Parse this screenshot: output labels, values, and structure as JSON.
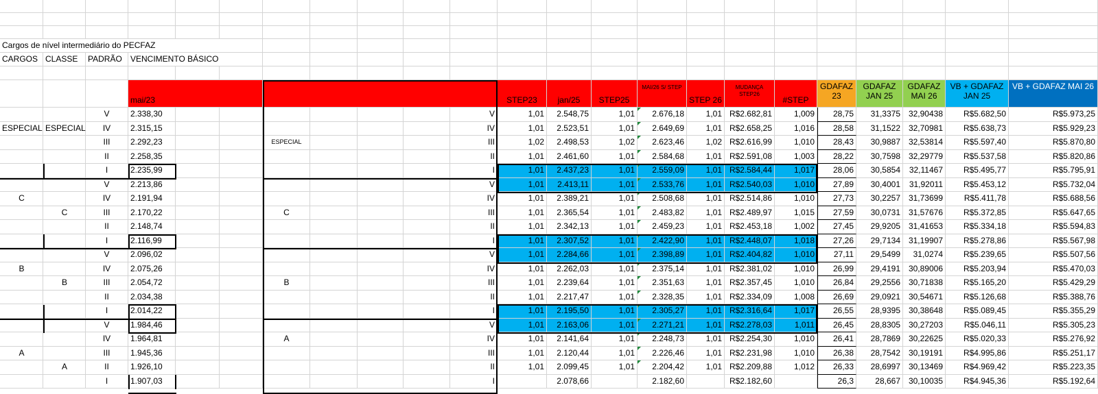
{
  "sheet": {
    "title": "Cargos de nível intermediário do PECFAZ",
    "col_labels": [
      "CARGOS",
      "CLASSE",
      "PADRÃO",
      "VENCIMENTO BÁSICO"
    ],
    "left_header": "mai/23",
    "headers": [
      "STEP23",
      "jan/25",
      "STEP25",
      "MAI/26 S/ STEP",
      "STEP 26",
      "MUDANÇA STEP26",
      "#STEP",
      "GDAFAZ 23",
      "GDAFAZ JAN 25",
      "GDAFAZ MAI 26",
      "VB + GDAFAZ JAN 25",
      "VB + GDAFAZ MAI 26"
    ],
    "group_labels": {
      "cargos": [
        "ESPECIAL",
        "C",
        "B",
        "A"
      ],
      "classe": [
        "ESPECIAL",
        "C",
        "B",
        "A"
      ],
      "middle": [
        "ESPECIAL",
        "C",
        "B",
        "A"
      ]
    },
    "colors": {
      "red": "#ff0000",
      "orange": "#f5a623",
      "green": "#92d050",
      "blue": "#00b0f0",
      "dark_blue": "#0070c0"
    },
    "rows": [
      {
        "p": "V",
        "vb": "2.338,30",
        "s23": "1,01",
        "jan": "2.548,75",
        "s25": "1,01",
        "mai": "2.676,18",
        "s26": "1,01",
        "mud": "R$2.682,81",
        "st": "1,009",
        "g23": "28,75",
        "gj": "31,3375",
        "gm": "32,90438",
        "vj": "R$5.682,50",
        "vm": "R$5.973,25"
      },
      {
        "p": "IV",
        "vb": "2.315,15",
        "s23": "1,01",
        "jan": "2.523,51",
        "s25": "1,01",
        "mai": "2.649,69",
        "s26": "1,01",
        "mud": "R$2.658,25",
        "st": "1,016",
        "g23": "28,58",
        "gj": "31,1522",
        "gm": "32,70981",
        "vj": "R$5.638,73",
        "vm": "R$5.929,23"
      },
      {
        "p": "III",
        "vb": "2.292,23",
        "s23": "1,02",
        "jan": "2.498,53",
        "s25": "1,02",
        "mai": "2.623,46",
        "s26": "1,02",
        "mud": "R$2.616,99",
        "st": "1,010",
        "g23": "28,43",
        "gj": "30,9887",
        "gm": "32,53814",
        "vj": "R$5.597,40",
        "vm": "R$5.870,80"
      },
      {
        "p": "II",
        "vb": "2.258,35",
        "s23": "1,01",
        "jan": "2.461,60",
        "s25": "1,01",
        "mai": "2.584,68",
        "s26": "1,01",
        "mud": "R$2.591,08",
        "st": "1,003",
        "g23": "28,22",
        "gj": "30,7598",
        "gm": "32,29779",
        "vj": "R$5.537,58",
        "vm": "R$5.820,86"
      },
      {
        "p": "I",
        "vb": "2.235,99",
        "s23": "1,01",
        "jan": "2.437,23",
        "s25": "1,01",
        "mai": "2.559,09",
        "s26": "1,01",
        "mud": "R$2.584,44",
        "st": "1,017",
        "g23": "28,06",
        "gj": "30,5854",
        "gm": "32,11467",
        "vj": "R$5.495,77",
        "vm": "R$5.795,91"
      },
      {
        "p": "V",
        "vb": "2.213,86",
        "s23": "1,01",
        "jan": "2.413,11",
        "s25": "1,01",
        "mai": "2.533,76",
        "s26": "1,01",
        "mud": "R$2.540,03",
        "st": "1,010",
        "g23": "27,89",
        "gj": "30,4001",
        "gm": "31,92011",
        "vj": "R$5.453,12",
        "vm": "R$5.732,04"
      },
      {
        "p": "IV",
        "vb": "2.191,94",
        "s23": "1,01",
        "jan": "2.389,21",
        "s25": "1,01",
        "mai": "2.508,68",
        "s26": "1,01",
        "mud": "R$2.514,86",
        "st": "1,010",
        "g23": "27,73",
        "gj": "30,2257",
        "gm": "31,73699",
        "vj": "R$5.411,78",
        "vm": "R$5.688,56"
      },
      {
        "p": "III",
        "vb": "2.170,22",
        "s23": "1,01",
        "jan": "2.365,54",
        "s25": "1,01",
        "mai": "2.483,82",
        "s26": "1,01",
        "mud": "R$2.489,97",
        "st": "1,015",
        "g23": "27,59",
        "gj": "30,0731",
        "gm": "31,57676",
        "vj": "R$5.372,85",
        "vm": "R$5.647,65"
      },
      {
        "p": "II",
        "vb": "2.148,74",
        "s23": "1,01",
        "jan": "2.342,13",
        "s25": "1,01",
        "mai": "2.459,23",
        "s26": "1,01",
        "mud": "R$2.453,18",
        "st": "1,002",
        "g23": "27,45",
        "gj": "29,9205",
        "gm": "31,41653",
        "vj": "R$5.334,18",
        "vm": "R$5.594,83"
      },
      {
        "p": "I",
        "vb": "2.116,99",
        "s23": "1,01",
        "jan": "2.307,52",
        "s25": "1,01",
        "mai": "2.422,90",
        "s26": "1,01",
        "mud": "R$2.448,07",
        "st": "1,018",
        "g23": "27,26",
        "gj": "29,7134",
        "gm": "31,19907",
        "vj": "R$5.278,86",
        "vm": "R$5.567,98"
      },
      {
        "p": "V",
        "vb": "2.096,02",
        "s23": "1,01",
        "jan": "2.284,66",
        "s25": "1,01",
        "mai": "2.398,89",
        "s26": "1,01",
        "mud": "R$2.404,82",
        "st": "1,010",
        "g23": "27,11",
        "gj": "29,5499",
        "gm": "31,0274",
        "vj": "R$5.239,65",
        "vm": "R$5.507,56"
      },
      {
        "p": "IV",
        "vb": "2.075,26",
        "s23": "1,01",
        "jan": "2.262,03",
        "s25": "1,01",
        "mai": "2.375,14",
        "s26": "1,01",
        "mud": "R$2.381,02",
        "st": "1,010",
        "g23": "26,99",
        "gj": "29,4191",
        "gm": "30,89006",
        "vj": "R$5.203,94",
        "vm": "R$5.470,03"
      },
      {
        "p": "III",
        "vb": "2.054,72",
        "s23": "1,01",
        "jan": "2.239,64",
        "s25": "1,01",
        "mai": "2.351,63",
        "s26": "1,01",
        "mud": "R$2.357,45",
        "st": "1,010",
        "g23": "26,84",
        "gj": "29,2556",
        "gm": "30,71838",
        "vj": "R$5.165,20",
        "vm": "R$5.429,29"
      },
      {
        "p": "II",
        "vb": "2.034,38",
        "s23": "1,01",
        "jan": "2.217,47",
        "s25": "1,01",
        "mai": "2.328,35",
        "s26": "1,01",
        "mud": "R$2.334,09",
        "st": "1,008",
        "g23": "26,69",
        "gj": "29,0921",
        "gm": "30,54671",
        "vj": "R$5.126,68",
        "vm": "R$5.388,76"
      },
      {
        "p": "I",
        "vb": "2.014,22",
        "s23": "1,01",
        "jan": "2.195,50",
        "s25": "1,01",
        "mai": "2.305,27",
        "s26": "1,01",
        "mud": "R$2.316,64",
        "st": "1,017",
        "g23": "26,55",
        "gj": "28,9395",
        "gm": "30,38648",
        "vj": "R$5.089,45",
        "vm": "R$5.355,29"
      },
      {
        "p": "V",
        "vb": "1.984,46",
        "s23": "1,01",
        "jan": "2.163,06",
        "s25": "1,01",
        "mai": "2.271,21",
        "s26": "1,01",
        "mud": "R$2.278,03",
        "st": "1,011",
        "g23": "26,45",
        "gj": "28,8305",
        "gm": "30,27203",
        "vj": "R$5.046,11",
        "vm": "R$5.305,23"
      },
      {
        "p": "IV",
        "vb": "1.964,81",
        "s23": "1,01",
        "jan": "2.141,64",
        "s25": "1,01",
        "mai": "2.248,73",
        "s26": "1,01",
        "mud": "R$2.254,30",
        "st": "1,010",
        "g23": "26,41",
        "gj": "28,7869",
        "gm": "30,22625",
        "vj": "R$5.020,33",
        "vm": "R$5.276,92"
      },
      {
        "p": "III",
        "vb": "1.945,36",
        "s23": "1,01",
        "jan": "2.120,44",
        "s25": "1,01",
        "mai": "2.226,46",
        "s26": "1,01",
        "mud": "R$2.231,98",
        "st": "1,010",
        "g23": "26,38",
        "gj": "28,7542",
        "gm": "30,19191",
        "vj": "R$4.995,86",
        "vm": "R$5.251,17"
      },
      {
        "p": "II",
        "vb": "1.926,10",
        "s23": "1,01",
        "jan": "2.099,45",
        "s25": "1,01",
        "mai": "2.204,42",
        "s26": "1,01",
        "mud": "R$2.209,88",
        "st": "1,012",
        "g23": "26,33",
        "gj": "28,6997",
        "gm": "30,13469",
        "vj": "R$4.969,42",
        "vm": "R$5.223,35"
      },
      {
        "p": "I",
        "vb": "1.907,03",
        "s23": "",
        "jan": "2.078,66",
        "s25": "",
        "mai": "2.182,60",
        "s26": "",
        "mud": "R$2.182,60",
        "st": "",
        "g23": "26,3",
        "gj": "28,667",
        "gm": "30,10035",
        "vj": "R$4.945,36",
        "vm": "R$5.192,64"
      }
    ]
  }
}
